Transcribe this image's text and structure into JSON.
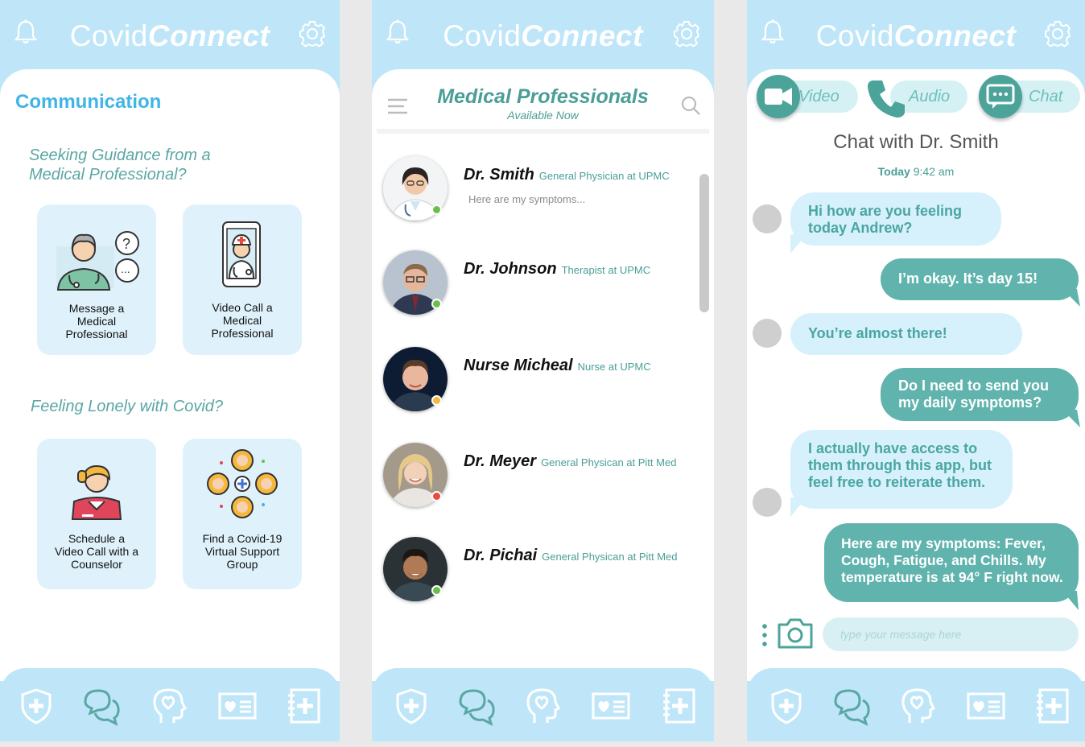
{
  "brand": {
    "part1": "Covid",
    "part2": "Connect"
  },
  "screen1": {
    "title": "Communication",
    "section1": {
      "line1": "Seeking Guidance from a",
      "line2": "Medical Professional?"
    },
    "section2": "Feeling Lonely with Covid?",
    "tiles": [
      {
        "l1": "Message a",
        "l2": "Medical",
        "l3": "Professional"
      },
      {
        "l1": "Video Call a",
        "l2": "Medical",
        "l3": "Professional"
      },
      {
        "l1": "Schedule a",
        "l2": "Video Call with a",
        "l3": "Counselor"
      },
      {
        "l1": "Find a Covid-19",
        "l2": "Virtual Support",
        "l3": "Group"
      }
    ]
  },
  "screen2": {
    "title": "Medical Professionals",
    "subtitle": "Available Now",
    "doctors": [
      {
        "name": "Dr. Smith",
        "role": "General Physician at UPMC",
        "message": "Here are my symptoms...",
        "status_color": "#6abf4b"
      },
      {
        "name": "Dr. Johnson",
        "role": "Therapist at UPMC",
        "message": "",
        "status_color": "#6abf4b"
      },
      {
        "name": "Nurse Micheal",
        "role": "Nurse at UPMC",
        "message": "",
        "status_color": "#f5b83d"
      },
      {
        "name": "Dr. Meyer",
        "role": "General Physican at Pitt Med",
        "message": "",
        "status_color": "#e74c3c"
      },
      {
        "name": "Dr. Pichai",
        "role": "General Physican at Pitt Med",
        "message": "",
        "status_color": "#6abf4b"
      }
    ]
  },
  "screen3": {
    "modes": {
      "video": "Video",
      "audio": "Audio",
      "chat": "Chat"
    },
    "title": "Chat with Dr. Smith",
    "time_day": "Today",
    "time_clock": "9:42 am",
    "messages": [
      {
        "dir": "in",
        "lines": [
          "Hi how are you feeling",
          "today Andrew?"
        ]
      },
      {
        "dir": "out",
        "lines": [
          "I’m okay. It’s day 15!"
        ]
      },
      {
        "dir": "in",
        "lines": [
          "You’re almost there!"
        ]
      },
      {
        "dir": "out",
        "lines": [
          "Do I need to send you",
          "my daily symptoms?"
        ]
      },
      {
        "dir": "in",
        "lines": [
          "I actually have access to",
          "them through this app, but",
          "feel free to reiterate them."
        ]
      },
      {
        "dir": "out",
        "lines": [
          "Here are my symptoms: Fever,",
          "Cough, Fatigue, and Chills. My",
          "temperature is at 94° F right now."
        ]
      }
    ],
    "input_placeholder": "type your message here"
  },
  "colors": {
    "sky": "#bfe6f8",
    "teal": "#4a9e96",
    "blue": "#3fb5e6",
    "tile": "#dff2fb"
  },
  "nav_icons": [
    "shield-plus-icon",
    "chat-bubbles-icon",
    "head-heart-icon",
    "id-card-heart-icon",
    "medical-notebook-icon"
  ]
}
